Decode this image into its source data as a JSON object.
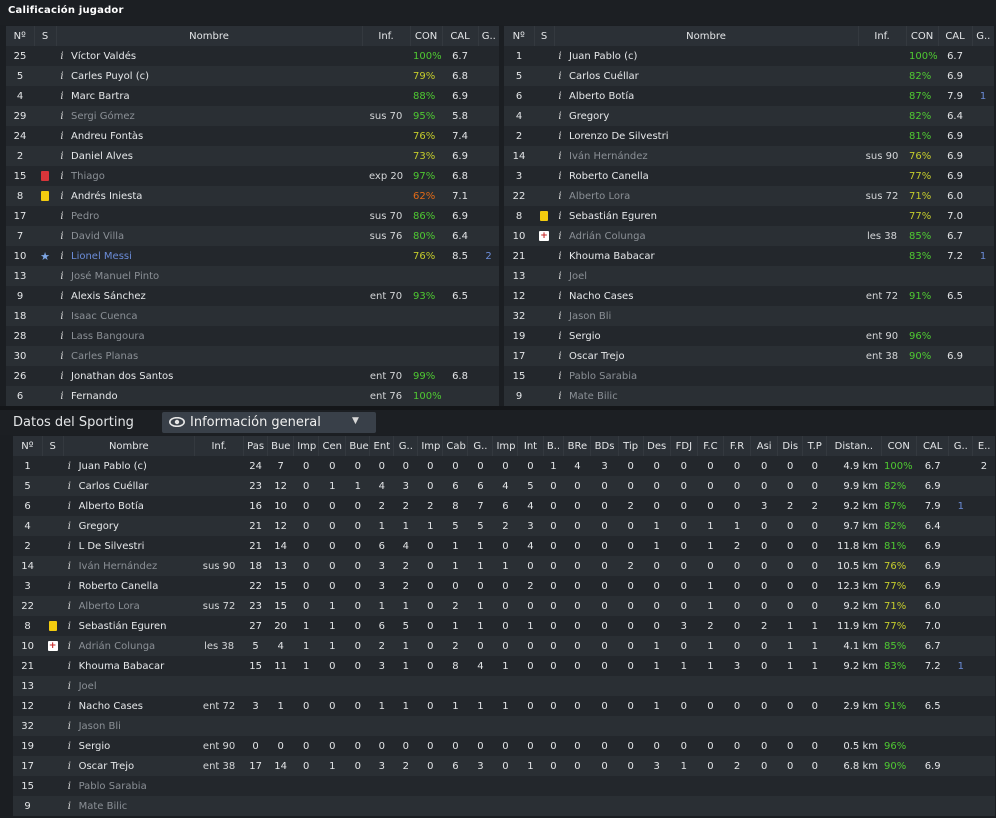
{
  "title": "Calificación jugador",
  "columns_top": {
    "num": "Nº",
    "status": "S",
    "name": "Nombre",
    "inf": "Inf.",
    "con": "CON",
    "cal": "CAL",
    "g": "G.."
  },
  "left_players": [
    {
      "num": "25",
      "status": "",
      "name": "Víctor Valdés",
      "dim": false,
      "inf": "",
      "con": "100%",
      "con_color": "green",
      "cal": "6.7",
      "g": ""
    },
    {
      "num": "5",
      "status": "",
      "name": "Carles Puyol (c)",
      "dim": false,
      "inf": "",
      "con": "79%",
      "con_color": "yellow",
      "cal": "6.8",
      "g": ""
    },
    {
      "num": "4",
      "status": "",
      "name": "Marc Bartra",
      "dim": false,
      "inf": "",
      "con": "88%",
      "con_color": "green",
      "cal": "6.9",
      "g": ""
    },
    {
      "num": "29",
      "status": "",
      "name": "Sergi Gómez",
      "dim": true,
      "inf": "sus 70",
      "con": "95%",
      "con_color": "green",
      "cal": "5.8",
      "g": ""
    },
    {
      "num": "24",
      "status": "",
      "name": "Andreu Fontàs",
      "dim": false,
      "inf": "",
      "con": "76%",
      "con_color": "yellow",
      "cal": "7.4",
      "g": ""
    },
    {
      "num": "2",
      "status": "",
      "name": "Daniel Alves",
      "dim": false,
      "inf": "",
      "con": "73%",
      "con_color": "yellow",
      "cal": "6.9",
      "g": ""
    },
    {
      "num": "15",
      "status": "red-card",
      "name": "Thiago",
      "dim": true,
      "inf": "exp 20",
      "con": "97%",
      "con_color": "green",
      "cal": "6.8",
      "g": ""
    },
    {
      "num": "8",
      "status": "yellow-card",
      "name": "Andrés Iniesta",
      "dim": false,
      "inf": "",
      "con": "62%",
      "con_color": "orange",
      "cal": "7.1",
      "g": ""
    },
    {
      "num": "17",
      "status": "",
      "name": "Pedro",
      "dim": true,
      "inf": "sus 70",
      "con": "86%",
      "con_color": "green",
      "cal": "6.9",
      "g": ""
    },
    {
      "num": "7",
      "status": "",
      "name": "David Villa",
      "dim": true,
      "inf": "sus 76",
      "con": "80%",
      "con_color": "green",
      "cal": "6.4",
      "g": ""
    },
    {
      "num": "10",
      "status": "star",
      "name": "Lionel Messi",
      "dim": false,
      "blue": true,
      "inf": "",
      "con": "76%",
      "con_color": "yellow",
      "cal": "8.5",
      "g": "2"
    },
    {
      "num": "13",
      "status": "",
      "name": "José Manuel Pinto",
      "dim": true,
      "inf": "",
      "con": "",
      "con_color": "",
      "cal": "",
      "g": ""
    },
    {
      "num": "9",
      "status": "",
      "name": "Alexis Sánchez",
      "dim": false,
      "inf": "ent 70",
      "con": "93%",
      "con_color": "green",
      "cal": "6.5",
      "g": ""
    },
    {
      "num": "18",
      "status": "",
      "name": "Isaac Cuenca",
      "dim": true,
      "inf": "",
      "con": "",
      "con_color": "",
      "cal": "",
      "g": ""
    },
    {
      "num": "28",
      "status": "",
      "name": "Lass Bangoura",
      "dim": true,
      "inf": "",
      "con": "",
      "con_color": "",
      "cal": "",
      "g": ""
    },
    {
      "num": "30",
      "status": "",
      "name": "Carles Planas",
      "dim": true,
      "inf": "",
      "con": "",
      "con_color": "",
      "cal": "",
      "g": ""
    },
    {
      "num": "26",
      "status": "",
      "name": "Jonathan dos Santos",
      "dim": false,
      "inf": "ent 70",
      "con": "99%",
      "con_color": "green",
      "cal": "6.8",
      "g": ""
    },
    {
      "num": "6",
      "status": "",
      "name": "Fernando",
      "dim": false,
      "inf": "ent 76",
      "con": "100%",
      "con_color": "green",
      "cal": "",
      "g": ""
    }
  ],
  "right_players": [
    {
      "num": "1",
      "status": "",
      "name": "Juan Pablo (c)",
      "dim": false,
      "inf": "",
      "con": "100%",
      "con_color": "green",
      "cal": "6.7",
      "g": ""
    },
    {
      "num": "5",
      "status": "",
      "name": "Carlos Cuéllar",
      "dim": false,
      "inf": "",
      "con": "82%",
      "con_color": "green",
      "cal": "6.9",
      "g": ""
    },
    {
      "num": "6",
      "status": "",
      "name": "Alberto Botía",
      "dim": false,
      "inf": "",
      "con": "87%",
      "con_color": "green",
      "cal": "7.9",
      "g": "1"
    },
    {
      "num": "4",
      "status": "",
      "name": "Gregory",
      "dim": false,
      "inf": "",
      "con": "82%",
      "con_color": "green",
      "cal": "6.4",
      "g": ""
    },
    {
      "num": "2",
      "status": "",
      "name": "Lorenzo De Silvestri",
      "dim": false,
      "inf": "",
      "con": "81%",
      "con_color": "green",
      "cal": "6.9",
      "g": ""
    },
    {
      "num": "14",
      "status": "",
      "name": "Iván Hernández",
      "dim": true,
      "inf": "sus 90",
      "con": "76%",
      "con_color": "yellow",
      "cal": "6.9",
      "g": ""
    },
    {
      "num": "3",
      "status": "",
      "name": "Roberto Canella",
      "dim": false,
      "inf": "",
      "con": "77%",
      "con_color": "yellow",
      "cal": "6.9",
      "g": ""
    },
    {
      "num": "22",
      "status": "",
      "name": "Alberto Lora",
      "dim": true,
      "inf": "sus 72",
      "con": "71%",
      "con_color": "yellow",
      "cal": "6.0",
      "g": ""
    },
    {
      "num": "8",
      "status": "yellow-card",
      "name": "Sebastián Eguren",
      "dim": false,
      "inf": "",
      "con": "77%",
      "con_color": "yellow",
      "cal": "7.0",
      "g": ""
    },
    {
      "num": "10",
      "status": "medic",
      "name": "Adrián Colunga",
      "dim": true,
      "inf": "les 38",
      "con": "85%",
      "con_color": "green",
      "cal": "6.7",
      "g": ""
    },
    {
      "num": "21",
      "status": "",
      "name": "Khouma Babacar",
      "dim": false,
      "inf": "",
      "con": "83%",
      "con_color": "green",
      "cal": "7.2",
      "g": "1"
    },
    {
      "num": "13",
      "status": "",
      "name": "Joel",
      "dim": true,
      "inf": "",
      "con": "",
      "con_color": "",
      "cal": "",
      "g": ""
    },
    {
      "num": "12",
      "status": "",
      "name": "Nacho Cases",
      "dim": false,
      "inf": "ent 72",
      "con": "91%",
      "con_color": "green",
      "cal": "6.5",
      "g": ""
    },
    {
      "num": "32",
      "status": "",
      "name": "Jason Bli",
      "dim": true,
      "inf": "",
      "con": "",
      "con_color": "",
      "cal": "",
      "g": ""
    },
    {
      "num": "19",
      "status": "",
      "name": "Sergio",
      "dim": false,
      "inf": "ent 90",
      "con": "96%",
      "con_color": "green",
      "cal": "",
      "g": ""
    },
    {
      "num": "17",
      "status": "",
      "name": "Oscar Trejo",
      "dim": false,
      "inf": "ent 38",
      "con": "90%",
      "con_color": "green",
      "cal": "6.9",
      "g": ""
    },
    {
      "num": "15",
      "status": "",
      "name": "Pablo Sarabia",
      "dim": true,
      "inf": "",
      "con": "",
      "con_color": "",
      "cal": "",
      "g": ""
    },
    {
      "num": "9",
      "status": "",
      "name": "Mate Bilic",
      "dim": true,
      "inf": "",
      "con": "",
      "con_color": "",
      "cal": "",
      "g": ""
    }
  ],
  "section": {
    "title": "Datos del Sporting",
    "view_label": "Información general"
  },
  "stat_columns": [
    "Nº",
    "S",
    "Nombre",
    "Inf.",
    "Pas",
    "Bue",
    "Imp",
    "Cen",
    "Bue",
    "Ent",
    "G..",
    "Imp",
    "Cab",
    "G..",
    "Imp",
    "Int",
    "B..",
    "BRe",
    "BDs",
    "Tip",
    "Des",
    "FDJ",
    "F.C",
    "F.R",
    "Asi",
    "Dis",
    "T.P",
    "Distan..",
    "CON",
    "CAL",
    "G..",
    "E.."
  ],
  "stat_rows": [
    {
      "num": "1",
      "status": "",
      "name": "Juan Pablo (c)",
      "dim": false,
      "inf": "",
      "stats": [
        "24",
        "7",
        "0",
        "0",
        "0",
        "0",
        "0",
        "0",
        "0",
        "0",
        "0",
        "0",
        "1",
        "4",
        "3",
        "0",
        "0",
        "0",
        "0",
        "0",
        "0",
        "0",
        "0"
      ],
      "dist": "4.9 km",
      "con": "100%",
      "con_color": "green",
      "cal": "6.7",
      "g": "",
      "e": "2"
    },
    {
      "num": "5",
      "status": "",
      "name": "Carlos Cuéllar",
      "dim": false,
      "inf": "",
      "stats": [
        "23",
        "12",
        "0",
        "1",
        "1",
        "4",
        "3",
        "0",
        "6",
        "6",
        "4",
        "5",
        "0",
        "0",
        "0",
        "0",
        "0",
        "0",
        "0",
        "0",
        "0",
        "0",
        "0"
      ],
      "dist": "9.9 km",
      "con": "82%",
      "con_color": "green",
      "cal": "6.9",
      "g": "",
      "e": ""
    },
    {
      "num": "6",
      "status": "",
      "name": "Alberto Botía",
      "dim": false,
      "inf": "",
      "stats": [
        "16",
        "10",
        "0",
        "0",
        "0",
        "2",
        "2",
        "2",
        "8",
        "7",
        "6",
        "4",
        "0",
        "0",
        "0",
        "2",
        "0",
        "0",
        "0",
        "0",
        "3",
        "2",
        "2"
      ],
      "dist": "9.2 km",
      "con": "87%",
      "con_color": "green",
      "cal": "7.9",
      "g": "1",
      "e": ""
    },
    {
      "num": "4",
      "status": "",
      "name": "Gregory",
      "dim": false,
      "inf": "",
      "stats": [
        "21",
        "12",
        "0",
        "0",
        "0",
        "1",
        "1",
        "1",
        "5",
        "5",
        "2",
        "3",
        "0",
        "0",
        "0",
        "0",
        "1",
        "0",
        "1",
        "1",
        "0",
        "0",
        "0"
      ],
      "dist": "9.7 km",
      "con": "82%",
      "con_color": "green",
      "cal": "6.4",
      "g": "",
      "e": ""
    },
    {
      "num": "2",
      "status": "",
      "name": "L De Silvestri",
      "dim": false,
      "inf": "",
      "stats": [
        "21",
        "14",
        "0",
        "0",
        "0",
        "6",
        "4",
        "0",
        "1",
        "1",
        "0",
        "4",
        "0",
        "0",
        "0",
        "0",
        "1",
        "0",
        "1",
        "2",
        "0",
        "0",
        "0"
      ],
      "dist": "11.8 km",
      "con": "81%",
      "con_color": "green",
      "cal": "6.9",
      "g": "",
      "e": ""
    },
    {
      "num": "14",
      "status": "",
      "name": "Iván Hernández",
      "dim": true,
      "inf": "sus 90",
      "stats": [
        "18",
        "13",
        "0",
        "0",
        "0",
        "3",
        "2",
        "0",
        "1",
        "1",
        "1",
        "0",
        "0",
        "0",
        "0",
        "2",
        "0",
        "0",
        "0",
        "0",
        "0",
        "0",
        "0"
      ],
      "dist": "10.5 km",
      "con": "76%",
      "con_color": "yellow",
      "cal": "6.9",
      "g": "",
      "e": ""
    },
    {
      "num": "3",
      "status": "",
      "name": "Roberto Canella",
      "dim": false,
      "inf": "",
      "stats": [
        "22",
        "15",
        "0",
        "0",
        "0",
        "3",
        "2",
        "0",
        "0",
        "0",
        "0",
        "2",
        "0",
        "0",
        "0",
        "0",
        "0",
        "0",
        "1",
        "0",
        "0",
        "0",
        "0"
      ],
      "dist": "12.3 km",
      "con": "77%",
      "con_color": "yellow",
      "cal": "6.9",
      "g": "",
      "e": ""
    },
    {
      "num": "22",
      "status": "",
      "name": "Alberto Lora",
      "dim": true,
      "inf": "sus 72",
      "stats": [
        "23",
        "15",
        "0",
        "1",
        "0",
        "1",
        "1",
        "0",
        "2",
        "1",
        "0",
        "0",
        "0",
        "0",
        "0",
        "0",
        "0",
        "0",
        "1",
        "0",
        "0",
        "0",
        "0"
      ],
      "dist": "9.2 km",
      "con": "71%",
      "con_color": "yellow",
      "cal": "6.0",
      "g": "",
      "e": ""
    },
    {
      "num": "8",
      "status": "yellow-card",
      "name": "Sebastián Eguren",
      "dim": false,
      "inf": "",
      "stats": [
        "27",
        "20",
        "1",
        "1",
        "0",
        "6",
        "5",
        "0",
        "1",
        "1",
        "0",
        "1",
        "0",
        "0",
        "0",
        "0",
        "0",
        "3",
        "2",
        "0",
        "2",
        "1",
        "1"
      ],
      "dist": "11.9 km",
      "con": "77%",
      "con_color": "yellow",
      "cal": "7.0",
      "g": "",
      "e": ""
    },
    {
      "num": "10",
      "status": "medic",
      "name": "Adrián Colunga",
      "dim": true,
      "inf": "les 38",
      "stats": [
        "5",
        "4",
        "1",
        "1",
        "0",
        "2",
        "1",
        "0",
        "2",
        "0",
        "0",
        "0",
        "0",
        "0",
        "0",
        "0",
        "1",
        "0",
        "1",
        "0",
        "0",
        "1",
        "1"
      ],
      "dist": "4.1 km",
      "con": "85%",
      "con_color": "green",
      "cal": "6.7",
      "g": "",
      "e": ""
    },
    {
      "num": "21",
      "status": "",
      "name": "Khouma Babacar",
      "dim": false,
      "inf": "",
      "stats": [
        "15",
        "11",
        "1",
        "0",
        "0",
        "3",
        "1",
        "0",
        "8",
        "4",
        "1",
        "0",
        "0",
        "0",
        "0",
        "0",
        "1",
        "1",
        "1",
        "3",
        "0",
        "1",
        "1"
      ],
      "dist": "9.2 km",
      "con": "83%",
      "con_color": "green",
      "cal": "7.2",
      "g": "1",
      "e": ""
    },
    {
      "num": "13",
      "status": "",
      "name": "Joel",
      "dim": true,
      "inf": "",
      "stats": [
        "",
        "",
        "",
        "",
        "",
        "",
        "",
        "",
        "",
        "",
        "",
        "",
        "",
        "",
        "",
        "",
        "",
        "",
        "",
        "",
        "",
        "",
        ""
      ],
      "dist": "",
      "con": "",
      "con_color": "",
      "cal": "",
      "g": "",
      "e": ""
    },
    {
      "num": "12",
      "status": "",
      "name": "Nacho Cases",
      "dim": false,
      "inf": "ent 72",
      "stats": [
        "3",
        "1",
        "0",
        "0",
        "0",
        "1",
        "1",
        "0",
        "1",
        "1",
        "1",
        "0",
        "0",
        "0",
        "0",
        "0",
        "1",
        "0",
        "0",
        "0",
        "0",
        "0",
        "0"
      ],
      "dist": "2.9 km",
      "con": "91%",
      "con_color": "green",
      "cal": "6.5",
      "g": "",
      "e": ""
    },
    {
      "num": "32",
      "status": "",
      "name": "Jason Bli",
      "dim": true,
      "inf": "",
      "stats": [
        "",
        "",
        "",
        "",
        "",
        "",
        "",
        "",
        "",
        "",
        "",
        "",
        "",
        "",
        "",
        "",
        "",
        "",
        "",
        "",
        "",
        "",
        ""
      ],
      "dist": "",
      "con": "",
      "con_color": "",
      "cal": "",
      "g": "",
      "e": ""
    },
    {
      "num": "19",
      "status": "",
      "name": "Sergio",
      "dim": false,
      "inf": "ent 90",
      "stats": [
        "0",
        "0",
        "0",
        "0",
        "0",
        "0",
        "0",
        "0",
        "0",
        "0",
        "0",
        "0",
        "0",
        "0",
        "0",
        "0",
        "0",
        "0",
        "0",
        "0",
        "0",
        "0",
        "0"
      ],
      "dist": "0.5 km",
      "con": "96%",
      "con_color": "green",
      "cal": "",
      "g": "",
      "e": ""
    },
    {
      "num": "17",
      "status": "",
      "name": "Oscar Trejo",
      "dim": false,
      "inf": "ent 38",
      "stats": [
        "17",
        "14",
        "0",
        "1",
        "0",
        "3",
        "2",
        "0",
        "6",
        "3",
        "0",
        "1",
        "0",
        "0",
        "0",
        "0",
        "3",
        "1",
        "0",
        "2",
        "0",
        "0",
        "0"
      ],
      "dist": "6.8 km",
      "con": "90%",
      "con_color": "green",
      "cal": "6.9",
      "g": "",
      "e": ""
    },
    {
      "num": "15",
      "status": "",
      "name": "Pablo Sarabia",
      "dim": true,
      "inf": "",
      "stats": [
        "",
        "",
        "",
        "",
        "",
        "",
        "",
        "",
        "",
        "",
        "",
        "",
        "",
        "",
        "",
        "",
        "",
        "",
        "",
        "",
        "",
        "",
        ""
      ],
      "dist": "",
      "con": "",
      "con_color": "",
      "cal": "",
      "g": "",
      "e": ""
    },
    {
      "num": "9",
      "status": "",
      "name": "Mate Bilic",
      "dim": true,
      "inf": "",
      "stats": [
        "",
        "",
        "",
        "",
        "",
        "",
        "",
        "",
        "",
        "",
        "",
        "",
        "",
        "",
        "",
        "",
        "",
        "",
        "",
        "",
        "",
        "",
        ""
      ],
      "dist": "",
      "con": "",
      "con_color": "",
      "cal": "",
      "g": "",
      "e": ""
    }
  ],
  "colors": {
    "green": "#4fc932",
    "yellow": "#c4cc2c",
    "orange": "#e26a17",
    "blue": "#6b8cd8",
    "header_bg": "#2b3036",
    "row_odd": "#23272c",
    "row_even": "#2a2f34"
  },
  "icons": {
    "info": "info-icon",
    "yellow_card": "yellow-card-icon",
    "red_card": "red-card-icon",
    "star": "star-icon",
    "medic": "injury-icon",
    "eye": "eye-icon",
    "dropdown": "chevron-down-icon"
  }
}
